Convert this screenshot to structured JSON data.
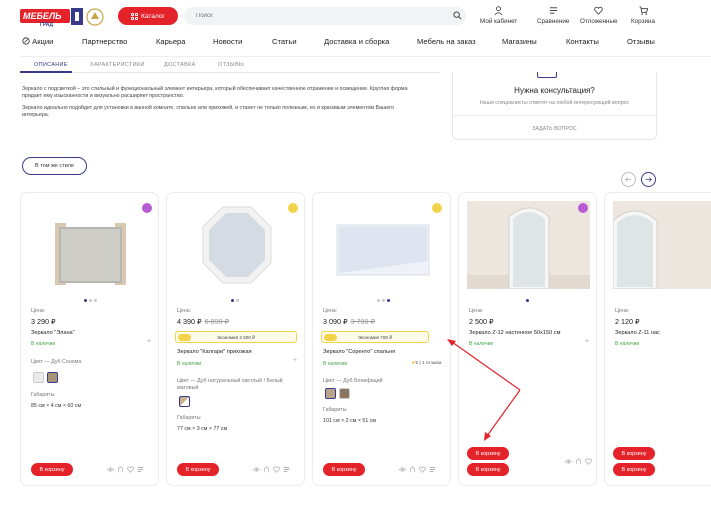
{
  "header": {
    "catalog_label": "Каталог",
    "search_placeholder": "Поиск",
    "links": [
      {
        "label": "Мой кабинет",
        "icon": "user-icon"
      },
      {
        "label": "Сравнение",
        "icon": "compare-icon"
      },
      {
        "label": "Отложенные",
        "icon": "heart-icon"
      },
      {
        "label": "Корзина",
        "icon": "cart-icon"
      }
    ]
  },
  "nav": [
    "Акции",
    "Партнерство",
    "Карьера",
    "Новости",
    "Статьи",
    "Доставка и сборка",
    "Мебель на заказ",
    "Магазины",
    "Контакты",
    "Отзывы"
  ],
  "tabs": [
    "ОПИСАНИЕ",
    "ХАРАКТЕРИСТИКИ",
    "ДОСТАВКА",
    "ОТЗЫВЫ"
  ],
  "description": [
    "Зеркало с подсветкой – это стильный и функциональный элемент интерьера, который обеспечивает качественное отражение и освещение. Круглая форма",
    "придает ему изысканности и визуально расширяет пространство.",
    "Зеркало идеально подойдет для установки в ванной комнате, спальне или прихожей, и станет не только полезным, но и красивым элементом Вашего",
    "интерьера."
  ],
  "consult": {
    "title": "Нужна консультация?",
    "subtitle": "Наши специалисты ответят на любой интересующий вопрос",
    "ask": "ЗАДАТЬ ВОПРОС"
  },
  "style_button": "В том же стиле",
  "colors": {
    "accent": "#e3222a",
    "brand": "#3a3a8a",
    "in_stock": "#45a84a",
    "economy": "#f3d34a",
    "badge_purple": "#b85cd6"
  },
  "common": {
    "price_label": "Цена:",
    "color_label": "Цвет",
    "dims_label": "Габариты",
    "cart_label": "В корзину",
    "stock_label": "В наличии"
  },
  "products": [
    {
      "price": "3 290 ₽",
      "old_price": "",
      "name": "Зеркало \"Элана\"",
      "economy": "",
      "color": "Дуб Сонома",
      "dims": "85 см × 4 см × 60 см",
      "rating": "",
      "badge": "purple"
    },
    {
      "price": "4 390 ₽",
      "old_price": "6 890 ₽",
      "name": "Зеркало \"Калгари\" прихожая",
      "economy": "Экономия 2 500 ₽",
      "color": "Дуб натуральный светлый / Белый матовый",
      "color_line1": "Дуб натуральный светлый / Белый",
      "color_line2": "матовый",
      "dims": "77 см × 3 см × 77 см",
      "rating": "",
      "badge": "yellow"
    },
    {
      "price": "3 090 ₽",
      "old_price": "3 790 ₽",
      "name": "Зеркало \"Соренто\" спальня",
      "economy": "Экономия 700 ₽",
      "color": "Дуб Бонифаций",
      "dims": "101 см × 2 см × 51 см",
      "rating": "5 | 1 отзыва",
      "badge": "yellow"
    },
    {
      "price": "2 500 ₽",
      "old_price": "",
      "name": "Зеркало Z-12 настенное 50х150 см",
      "economy": "",
      "color": "",
      "dims": "",
      "rating": "",
      "badge": "purple"
    },
    {
      "price": "2 120 ₽",
      "old_price": "",
      "name": "Зеркало Z-11 нас",
      "economy": "",
      "color": "",
      "dims": "",
      "rating": "",
      "badge": ""
    }
  ]
}
